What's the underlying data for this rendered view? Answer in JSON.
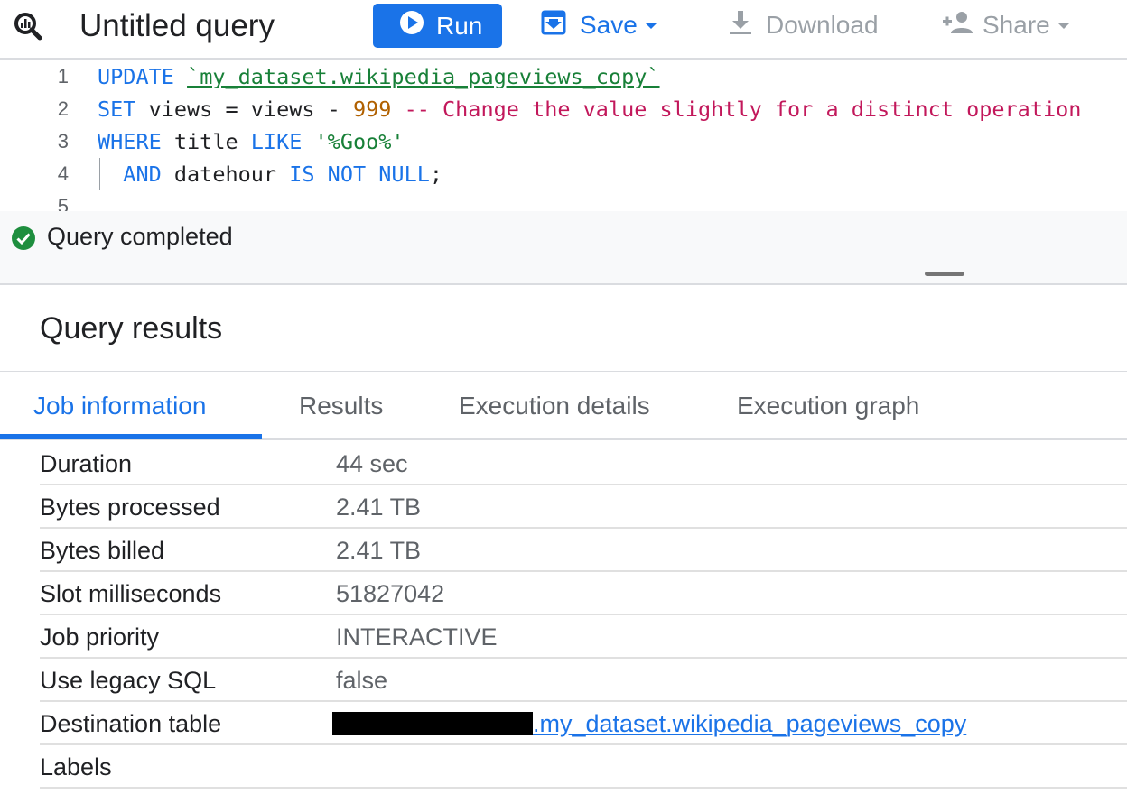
{
  "toolbar": {
    "title": "Untitled query",
    "run_label": "Run",
    "save_label": "Save",
    "download_label": "Download",
    "share_label": "Share",
    "icons": {
      "query": "bigquery-query-icon",
      "run": "play-icon",
      "save": "save-icon",
      "download": "download-icon",
      "share": "person-add-icon"
    }
  },
  "editor": {
    "lines": [
      {
        "number": "1",
        "tokens": [
          {
            "t": "UPDATE ",
            "c": "kw"
          },
          {
            "t": "`my_dataset.wikipedia_pageviews_copy`",
            "c": "bt"
          }
        ]
      },
      {
        "number": "2",
        "tokens": [
          {
            "t": "SET ",
            "c": "kw"
          },
          {
            "t": "views = views - ",
            "c": "plain"
          },
          {
            "t": "999",
            "c": "num"
          },
          {
            "t": " -- Change the value slightly for a distinct operation",
            "c": "cm"
          }
        ]
      },
      {
        "number": "3",
        "tokens": [
          {
            "t": "WHERE ",
            "c": "kw"
          },
          {
            "t": "title ",
            "c": "plain"
          },
          {
            "t": "LIKE ",
            "c": "kw"
          },
          {
            "t": "'%Goo%'",
            "c": "str"
          }
        ]
      },
      {
        "number": "4",
        "tokens": [
          {
            "t": "  AND ",
            "c": "kw"
          },
          {
            "t": "datehour ",
            "c": "plain"
          },
          {
            "t": "IS NOT NULL",
            "c": "kw"
          },
          {
            "t": ";",
            "c": "plain"
          }
        ]
      },
      {
        "number": "5",
        "tokens": []
      }
    ]
  },
  "status": {
    "text": "Query completed",
    "icon": "check-circle-icon",
    "color": "#1e8e3e"
  },
  "results": {
    "title": "Query results",
    "tabs": [
      {
        "label": "Job information",
        "active": true
      },
      {
        "label": "Results",
        "active": false
      },
      {
        "label": "Execution details",
        "active": false
      },
      {
        "label": "Execution graph",
        "active": false
      }
    ],
    "job_info": [
      {
        "key": "Duration",
        "value": "44 sec"
      },
      {
        "key": "Bytes processed",
        "value": "2.41 TB"
      },
      {
        "key": "Bytes billed",
        "value": "2.41 TB"
      },
      {
        "key": "Slot milliseconds",
        "value": "51827042"
      },
      {
        "key": "Job priority",
        "value": "INTERACTIVE"
      },
      {
        "key": "Use legacy SQL",
        "value": "false"
      },
      {
        "key": "Destination table",
        "value": ".my_dataset.wikipedia_pageviews_copy",
        "redacted_prefix": true
      },
      {
        "key": "Labels",
        "value": ""
      }
    ]
  },
  "colors": {
    "accent": "#1a73e8",
    "keyword": "#1a73e8",
    "string": "#188038",
    "number": "#b06000",
    "comment": "#c2185b",
    "disabled": "#9aa0a6"
  }
}
